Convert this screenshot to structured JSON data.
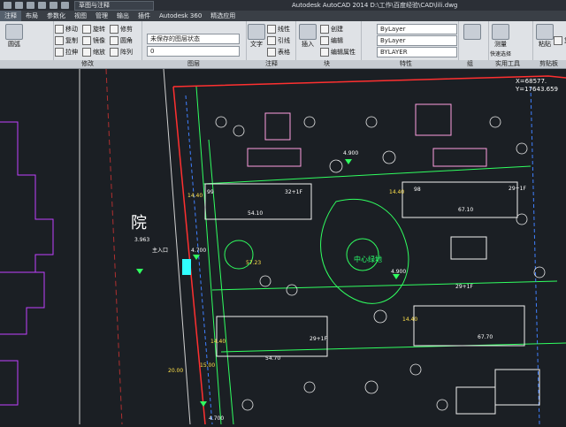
{
  "title": {
    "workspace": "草图与注释",
    "app_title": "Autodesk AutoCAD 2014   D:\\工作\\百度经验\\CAD\\lili.dwg"
  },
  "menu": {
    "tabs": [
      "注释",
      "布局",
      "参数化",
      "视图",
      "管理",
      "输出",
      "插件",
      "Autodesk 360",
      "精选应用"
    ]
  },
  "ribbon": {
    "modify_tools": [
      "移动",
      "旋转",
      "修剪",
      "复制",
      "镜像",
      "圆角",
      "拉伸",
      "缩放",
      "阵列"
    ],
    "draw_label": "圆弧",
    "layer_state": "未保存的图层状态",
    "layer_name": "0",
    "annotation": {
      "text": "文字",
      "linear": "线性",
      "leader": "引线",
      "table": "表格"
    },
    "block": {
      "insert": "插入",
      "create": "创建",
      "edit": "编辑",
      "edit_attr": "编辑属性"
    },
    "properties": {
      "color": "ByLayer",
      "linetype": "ByLayer",
      "lineweight": "BYLAYER"
    },
    "group": "组",
    "utilities": {
      "measure": "测量",
      "quick_select": "快速选择"
    },
    "clipboard": {
      "paste": "粘贴",
      "copy": "复制"
    },
    "panel_names": [
      "修改",
      "图层",
      "注释",
      "块",
      "特性",
      "组",
      "实用工具",
      "剪贴板"
    ]
  },
  "drawing": {
    "coord_x": "X=68577.",
    "coord_y": "Y=17643.659",
    "labels": [
      {
        "t": "院",
        "cls": "c-white"
      },
      {
        "t": "3.963",
        "cls": "c-white"
      },
      {
        "t": "主入口",
        "cls": "c-white"
      },
      {
        "t": "4.700",
        "cls": "c-white"
      },
      {
        "t": "4.900",
        "cls": "c-white"
      },
      {
        "t": "4.900",
        "cls": "c-white"
      },
      {
        "t": "中心绿地",
        "cls": "c-green"
      },
      {
        "t": "54.10",
        "cls": "c-white"
      },
      {
        "t": "67.10",
        "cls": "c-white"
      },
      {
        "t": "54.70",
        "cls": "c-white"
      },
      {
        "t": "67.70",
        "cls": "c-white"
      },
      {
        "t": "32+1F",
        "cls": "c-white"
      },
      {
        "t": "29+1F",
        "cls": "c-white"
      },
      {
        "t": "29+1F",
        "cls": "c-white"
      },
      {
        "t": "29+1F",
        "cls": "c-white"
      },
      {
        "t": "20.00",
        "cls": "c-yellow"
      },
      {
        "t": "15.00",
        "cls": "c-yellow"
      },
      {
        "t": "14.40",
        "cls": "c-yellow"
      },
      {
        "t": "14.40",
        "cls": "c-yellow"
      },
      {
        "t": "14.40",
        "cls": "c-yellow"
      },
      {
        "t": "14.40",
        "cls": "c-yellow"
      },
      {
        "t": "57.23",
        "cls": "c-yellow"
      },
      {
        "t": "4.700",
        "cls": "c-white"
      },
      {
        "t": "99",
        "cls": "c-white"
      },
      {
        "t": "98",
        "cls": "c-white"
      }
    ]
  }
}
